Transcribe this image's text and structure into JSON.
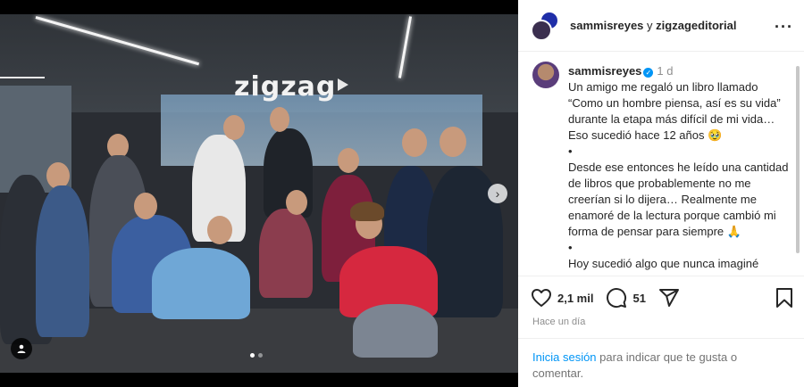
{
  "post": {
    "header": {
      "user1": "sammisreyes",
      "connector": "y",
      "user2": "zigzageditorial",
      "more_icon": "more-horizontal-icon"
    },
    "caption": {
      "username": "sammisreyes",
      "verified_icon": "verified-badge-icon",
      "time": "1 d",
      "paragraph1": "Un amigo me regaló un libro llamado “Como un hombre piensa, así es su vida” durante la etapa más difícil de mi vida… Eso sucedió hace 12 años 🥹",
      "bullet": "•",
      "paragraph2": "Desde ese entonces he leído una cantidad de libros que probablemente no me creerían si lo dijera… Realmente me enamoré de la lectura porque cambió mi forma de pensar para siempre 🙏",
      "bullet2": "•",
      "paragraph3": "Hoy sucedió algo que nunca imaginé"
    },
    "media": {
      "sign_text": "zigzag",
      "next_icon": "chevron-right-icon",
      "user_tag_icon": "user-tag-icon",
      "slide_index": 1,
      "slide_count": 2
    },
    "actions": {
      "like_icon": "heart-icon",
      "likes": "2,1 mil",
      "comment_icon": "comment-icon",
      "comments": "51",
      "share_icon": "share-icon",
      "save_icon": "bookmark-icon",
      "posted": "Hace un día"
    },
    "login_prompt": {
      "link": "Inicia sesión",
      "text": " para indicar que te gusta o comentar."
    }
  },
  "colors": {
    "accent": "#0095f6",
    "text": "#262626",
    "muted": "#8e8e8e"
  }
}
